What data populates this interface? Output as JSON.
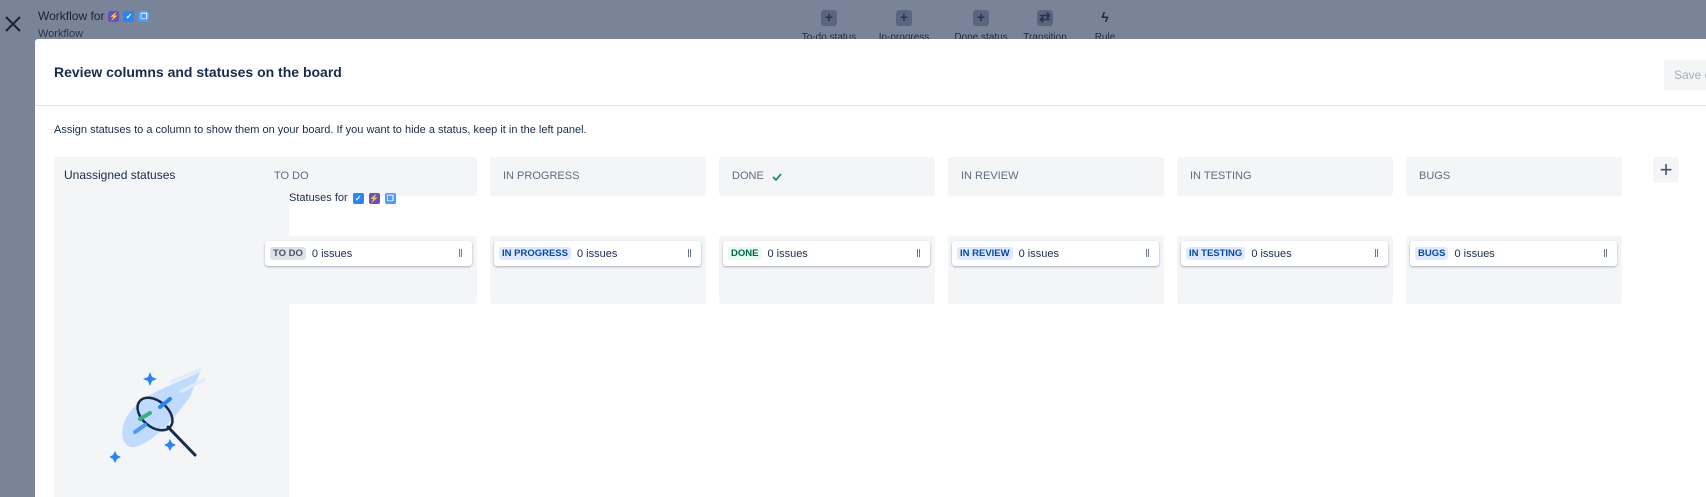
{
  "background": {
    "title": "Workflow for",
    "subtitle": "Workflow",
    "toolbar": [
      {
        "label": "To-do status",
        "icon": "plus-icon"
      },
      {
        "label": "In-progress status",
        "icon": "plus-icon"
      },
      {
        "label": "Done status",
        "icon": "plus-icon"
      },
      {
        "label": "Transition",
        "icon": "transition-icon"
      },
      {
        "label": "Rule",
        "icon": "lightning-icon"
      }
    ]
  },
  "modal": {
    "title": "Review columns and statuses on the board",
    "save_label": "Save ch",
    "description": "Assign statuses to a column to show them on your board. If you want to hide a status, keep it in the left panel.",
    "unassigned_title": "Unassigned statuses",
    "statuses_for": "Statuses for",
    "columns": [
      {
        "name": "TO DO",
        "status": "TO DO",
        "count": "0 issues",
        "tone": "grey"
      },
      {
        "name": "IN PROGRESS",
        "status": "IN PROGRESS",
        "count": "0 issues",
        "tone": "blue"
      },
      {
        "name": "DONE",
        "status": "DONE",
        "count": "0 issues",
        "tone": "green",
        "done_check": true
      },
      {
        "name": "IN REVIEW",
        "status": "IN REVIEW",
        "count": "0 issues",
        "tone": "blue"
      },
      {
        "name": "IN TESTING",
        "status": "IN TESTING",
        "count": "0 issues",
        "tone": "blue"
      },
      {
        "name": "BUGS",
        "status": "BUGS",
        "count": "0 issues",
        "tone": "blue"
      }
    ],
    "add_column_icon": "plus-icon"
  }
}
